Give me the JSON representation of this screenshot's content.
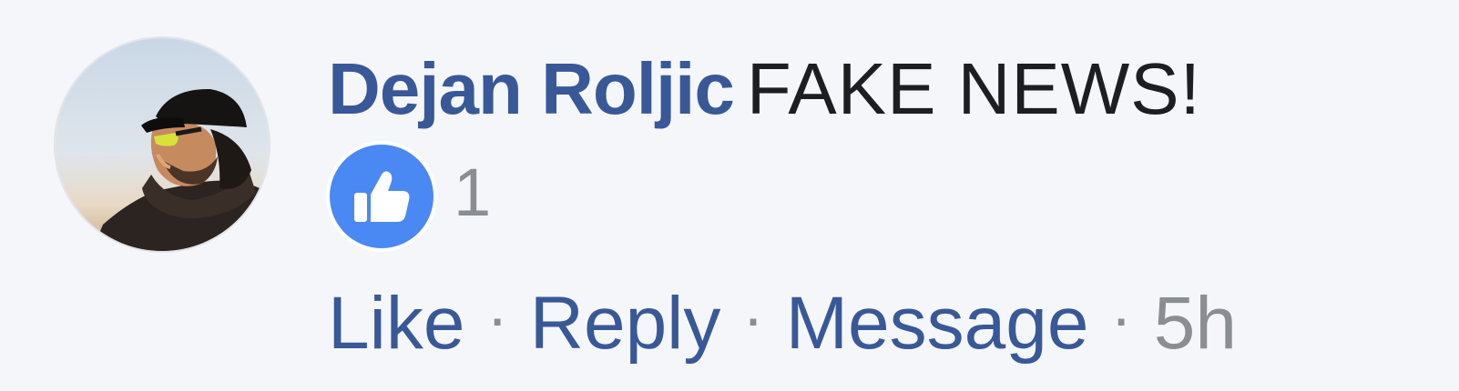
{
  "comment": {
    "author": "Dejan Roljic",
    "text": "FAKE NEWS!",
    "reaction": {
      "icon": "like-icon",
      "count": "1"
    },
    "actions": {
      "like": "Like",
      "reply": "Reply",
      "message": "Message",
      "separator": "·"
    },
    "timestamp": "5h"
  },
  "colors": {
    "background": "#f5f6f9",
    "link": "#385898",
    "text": "#1c1e21",
    "muted": "#8a8d91",
    "like_blue": "#4a89f3"
  }
}
